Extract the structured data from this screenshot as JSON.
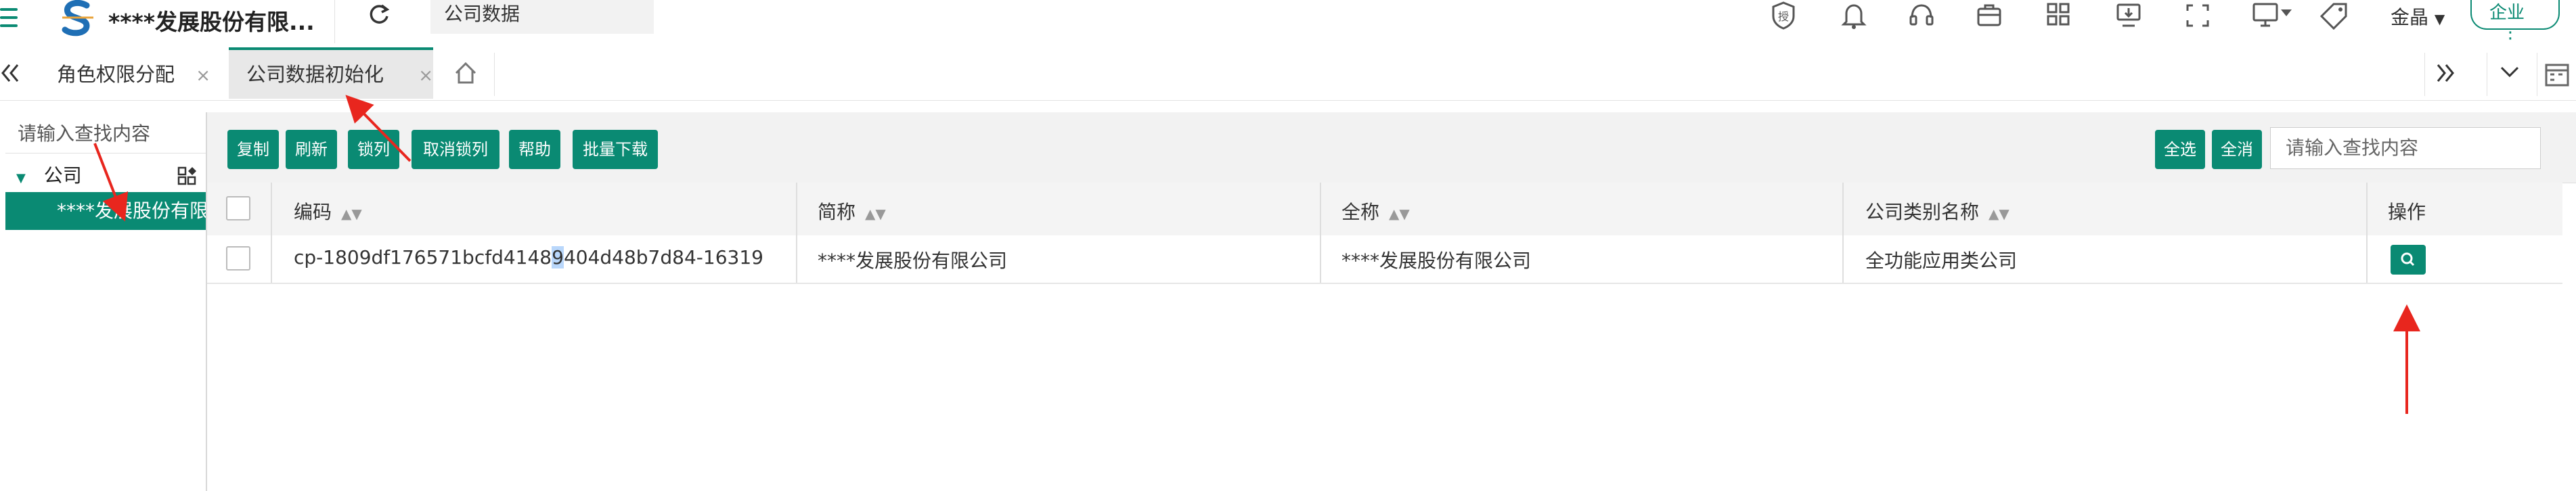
{
  "header": {
    "app_title": "****发展股份有限...",
    "search_text": "公司数据",
    "user_name": "金晶",
    "enterprise_label": "企业",
    "badge_char": "授",
    "colors": {
      "accent": "#0a8a73"
    },
    "icons": [
      "badge-icon",
      "bell-icon",
      "headset-icon",
      "briefcase-icon",
      "apps-icon",
      "monitor-icon",
      "fullscreen-icon",
      "display-icon",
      "tag-icon"
    ]
  },
  "tabs": {
    "items": [
      {
        "label": "角色权限分配",
        "close": "×"
      },
      {
        "label": "公司数据初始化",
        "close": "×"
      }
    ],
    "active_index": 1
  },
  "tree": {
    "search_placeholder": "请输入查找内容",
    "root_label": "公司",
    "selected_label": "****发展股份有限公司"
  },
  "toolbar": {
    "copy": "复制",
    "refresh": "刷新",
    "lock_column": "锁列",
    "unlock_column": "取消锁列",
    "help": "帮助",
    "batch_download": "批量下载",
    "select_all": "全选",
    "deselect_all": "全消",
    "search_placeholder": "请输入查找内容"
  },
  "table": {
    "columns": [
      "编码",
      "简称",
      "全称",
      "公司类别名称",
      "操作"
    ],
    "sort_glyph": "▲▼",
    "rows": [
      {
        "code_pre": "cp-1809df176571bcfd4148",
        "code_hl": "9",
        "code_post": "404d48b7d84-16319",
        "short_name": "****发展股份有限公司",
        "full_name": "****发展股份有限公司",
        "category": "全功能应用类公司"
      }
    ]
  }
}
